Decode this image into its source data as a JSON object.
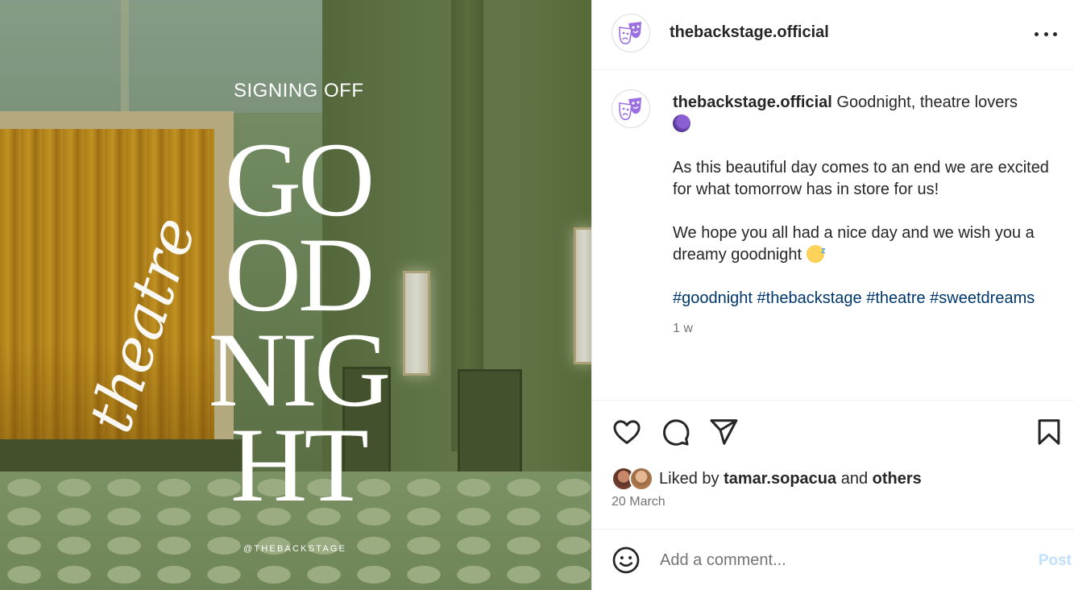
{
  "post_image": {
    "kicker": "SIGNING OFF",
    "headline_lines": [
      "GO",
      "OD",
      "NIG",
      "HT"
    ],
    "script_word": "theatre",
    "handle": "@THEBACKSTAGE"
  },
  "header": {
    "username": "thebackstage.official",
    "more_icon": "more-options-icon"
  },
  "caption": {
    "username": "thebackstage.official",
    "first_line": "Goodnight, theatre lovers",
    "paragraph_1": "As this beautiful day comes to an end we are excited for what tomorrow has in store for us!",
    "paragraph_2": "We hope you all had a nice day and we wish you a dreamy goodnight",
    "hashtags": [
      "#goodnight",
      "#thebackstage",
      "#theatre",
      "#sweetdreams"
    ],
    "time": "1 w"
  },
  "actions": {
    "like_icon": "heart-icon",
    "comment_icon": "comment-bubble-icon",
    "share_icon": "paper-plane-icon",
    "save_icon": "bookmark-icon"
  },
  "likes": {
    "prefix": "Liked by",
    "user": "tamar.sopacua",
    "conjunction": "and",
    "others": "others"
  },
  "date": "20 March",
  "comment_box": {
    "placeholder": "Add a comment...",
    "post_label": "Post"
  },
  "colors": {
    "hashtag": "#00376b",
    "post_disabled": "#c0dffd",
    "text_secondary": "#737373"
  }
}
